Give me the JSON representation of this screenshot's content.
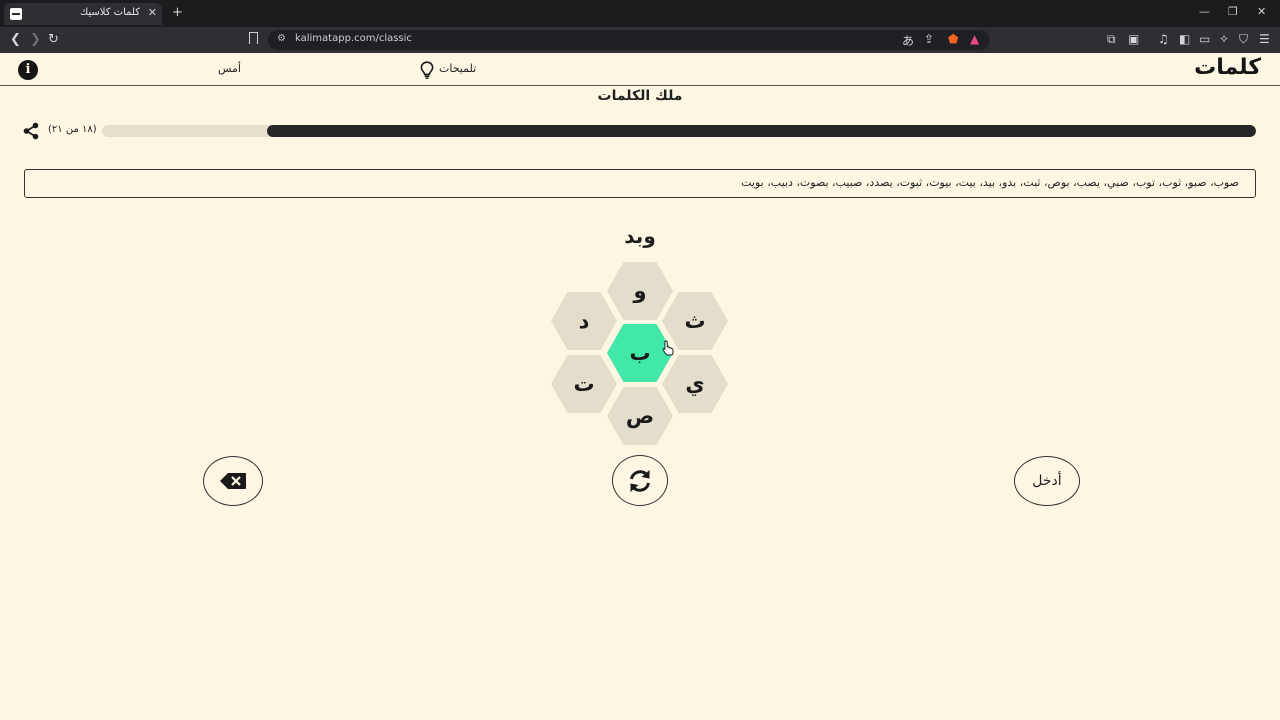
{
  "browser": {
    "tab_title": "كلمات كلاسيك",
    "new_tab_symbol": "+",
    "url": "kalimatapp.com/classic"
  },
  "header": {
    "logo": "كلمات",
    "hints_label": "تلميحات",
    "yesterday_label": "أمس",
    "info_symbol": "i"
  },
  "rank_title": "ملك الكلمات",
  "progress": {
    "count_text": "(١٨ من ٢١)",
    "found": 18,
    "total": 21,
    "fraction": 0.857
  },
  "found_words_text": "صوب، صبو، ثوب، توب، صبي، يصب، بوص، ثبت، بدو، بيد، بيت، بيوت، ثبوت، يصدد، صبيب، بصوت، دبيب، بويت",
  "current_word": "وبد",
  "hive": {
    "top": "و",
    "top_left": "د",
    "top_right": "ث",
    "center": "ب",
    "bottom_left": "ت",
    "bottom_right": "ي",
    "bottom": "ص"
  },
  "buttons": {
    "enter_label": "أدخل"
  },
  "colors": {
    "background": "#fdf6e3",
    "center_hex": "#41e8a8",
    "outer_hex": "#e3ddcb",
    "progress_fill": "#262626"
  }
}
